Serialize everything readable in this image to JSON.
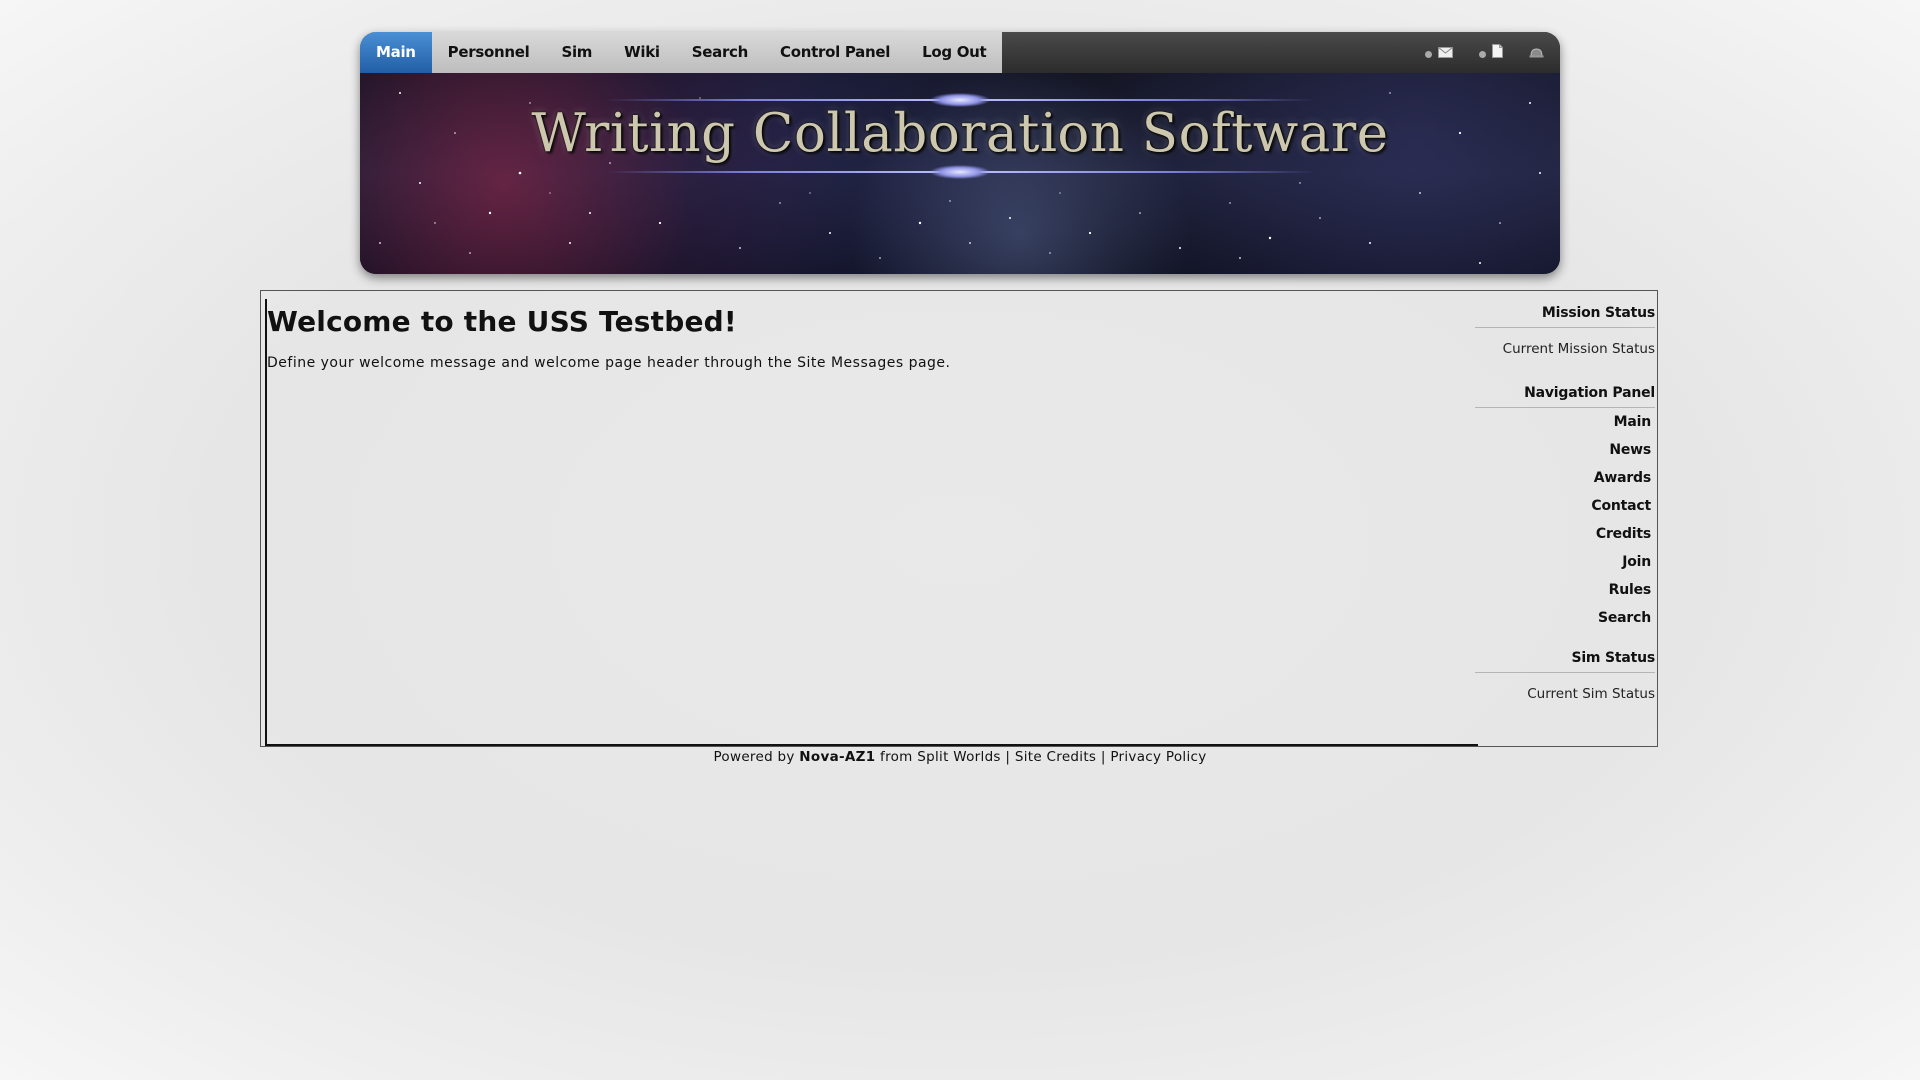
{
  "nav": {
    "tabs": [
      {
        "label": "Main",
        "active": true
      },
      {
        "label": "Personnel"
      },
      {
        "label": "Sim"
      },
      {
        "label": "Wiki"
      },
      {
        "label": "Search"
      },
      {
        "label": "Control Panel"
      },
      {
        "label": "Log Out"
      }
    ],
    "icons": [
      "mail-icon",
      "document-icon",
      "hat-icon"
    ]
  },
  "banner": {
    "title": "Writing Collaboration Software"
  },
  "main": {
    "title": "Welcome to the USS Testbed!",
    "message": "Define your welcome message and welcome page header through the Site Messages page."
  },
  "sidebar": {
    "mission_status": {
      "heading": "Mission Status",
      "item": "Current Mission Status"
    },
    "navigation": {
      "heading": "Navigation Panel",
      "items": [
        "Main",
        "News",
        "Awards",
        "Contact",
        "Credits",
        "Join",
        "Rules",
        "Search"
      ]
    },
    "sim_status": {
      "heading": "Sim Status",
      "item": "Current Sim Status"
    }
  },
  "footer": {
    "powered_by": "Powered by",
    "brand": "Nova-AZ1",
    "from": "from Split Worlds",
    "sep1": "|",
    "site_credits": "Site Credits",
    "sep2": "|",
    "privacy": "Privacy Policy"
  },
  "colors": {
    "active_tab": "#3776bd",
    "page_background": "#e8e8e8",
    "banner_title": "#cdc7ae"
  }
}
